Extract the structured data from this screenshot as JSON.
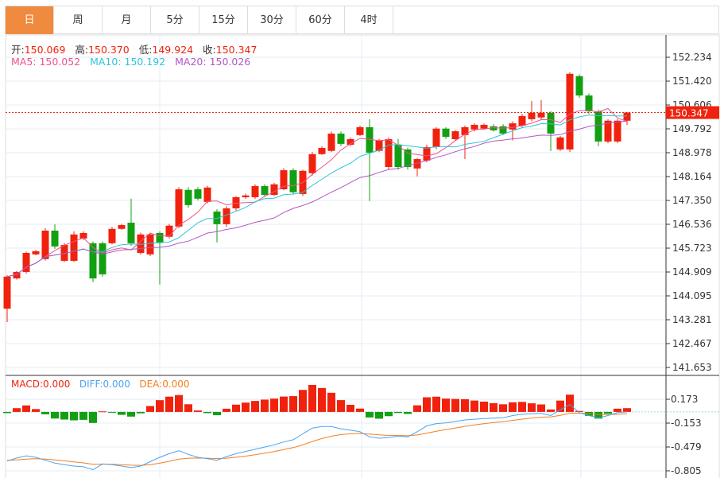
{
  "tabs": [
    {
      "label": "日",
      "active": true
    },
    {
      "label": "周"
    },
    {
      "label": "月"
    },
    {
      "label": "5分"
    },
    {
      "label": "15分"
    },
    {
      "label": "30分"
    },
    {
      "label": "60分"
    },
    {
      "label": "4时"
    }
  ],
  "ohlc_info": {
    "open_label": "开:",
    "open": "150.069",
    "high_label": "高:",
    "high": "150.370",
    "low_label": "低:",
    "low": "149.924",
    "close_label": "收:",
    "close": "150.347"
  },
  "ma_info": {
    "ma5": "MA5: 150.052",
    "ma10": "MA10: 150.192",
    "ma20": "MA20: 150.026"
  },
  "macd_info": {
    "macd": "MACD:0.000",
    "diff": "DIFF:0.000",
    "dea": "DEA:0.000"
  },
  "current_price": "150.347",
  "colors": {
    "up": "#f0220e",
    "down": "#12a012",
    "ma5": "#f0528a",
    "ma10": "#2ec4d8",
    "ma20": "#b156c4",
    "diff": "#4aa3f0",
    "dea": "#f57e20",
    "accent": "#f08a3e"
  },
  "chart_data": {
    "type": "candlestick",
    "price_axis": {
      "ticks": [
        "152.234",
        "151.420",
        "150.606",
        "149.792",
        "148.978",
        "148.164",
        "147.350",
        "146.536",
        "145.723",
        "144.909",
        "144.095",
        "143.281",
        "142.467",
        "141.653"
      ],
      "range": [
        141.653,
        152.234
      ]
    },
    "macd_axis": {
      "ticks": [
        "0.173",
        "-0.153",
        "-0.479",
        "-0.805"
      ],
      "range": [
        -0.805,
        0.173
      ]
    },
    "candles": [
      [
        143.66,
        144.75,
        144.8,
        143.2
      ],
      [
        144.69,
        144.91,
        144.95,
        144.65
      ],
      [
        144.91,
        145.56,
        145.6,
        144.85
      ],
      [
        145.51,
        145.62,
        145.66,
        145.48
      ],
      [
        145.35,
        146.32,
        146.4,
        145.3
      ],
      [
        146.32,
        145.78,
        146.54,
        145.7
      ],
      [
        145.29,
        145.83,
        145.9,
        145.25
      ],
      [
        145.29,
        146.19,
        146.3,
        145.25
      ],
      [
        146.05,
        146.24,
        146.3,
        146.0
      ],
      [
        145.89,
        144.69,
        145.95,
        144.56
      ],
      [
        145.89,
        144.83,
        145.95,
        144.75
      ],
      [
        145.89,
        146.38,
        146.45,
        145.85
      ],
      [
        146.38,
        146.51,
        146.55,
        146.35
      ],
      [
        146.59,
        145.89,
        147.41,
        145.8
      ],
      [
        145.56,
        146.19,
        146.25,
        145.5
      ],
      [
        145.51,
        146.19,
        146.25,
        145.45
      ],
      [
        146.24,
        145.92,
        146.3,
        144.48
      ],
      [
        146.11,
        146.49,
        146.55,
        146.05
      ],
      [
        146.46,
        147.73,
        147.8,
        146.4
      ],
      [
        147.71,
        147.19,
        147.8,
        147.1
      ],
      [
        147.73,
        147.41,
        147.8,
        147.35
      ],
      [
        147.3,
        147.79,
        147.85,
        147.25
      ],
      [
        146.97,
        146.54,
        147.05,
        145.92
      ],
      [
        146.54,
        147.08,
        147.15,
        146.45
      ],
      [
        147.08,
        147.46,
        147.5,
        147.0
      ],
      [
        147.46,
        147.52,
        147.58,
        147.4
      ],
      [
        147.46,
        147.84,
        147.9,
        147.4
      ],
      [
        147.84,
        147.54,
        147.9,
        147.5
      ],
      [
        147.54,
        147.9,
        147.95,
        147.5
      ],
      [
        147.73,
        148.38,
        148.45,
        147.7
      ],
      [
        148.38,
        147.63,
        148.45,
        147.55
      ],
      [
        147.57,
        148.36,
        148.4,
        147.5
      ],
      [
        148.28,
        148.93,
        149.0,
        148.2
      ],
      [
        148.93,
        149.14,
        149.2,
        148.9
      ],
      [
        149.04,
        149.63,
        149.7,
        149.0
      ],
      [
        149.63,
        149.28,
        149.7,
        149.2
      ],
      [
        149.25,
        149.44,
        149.5,
        149.2
      ],
      [
        149.58,
        149.85,
        149.9,
        149.55
      ],
      [
        149.85,
        148.98,
        150.12,
        147.33
      ],
      [
        149.04,
        149.39,
        149.45,
        149.0
      ],
      [
        148.49,
        149.44,
        149.5,
        148.4
      ],
      [
        149.25,
        148.49,
        149.45,
        148.4
      ],
      [
        149.09,
        148.49,
        149.15,
        148.4
      ],
      [
        148.44,
        148.76,
        148.8,
        148.17
      ],
      [
        148.71,
        149.17,
        149.25,
        148.65
      ],
      [
        149.17,
        149.8,
        149.85,
        149.1
      ],
      [
        149.8,
        149.52,
        149.85,
        149.45
      ],
      [
        149.44,
        149.71,
        149.75,
        149.4
      ],
      [
        149.58,
        149.85,
        149.9,
        148.76
      ],
      [
        149.77,
        149.93,
        149.98,
        149.7
      ],
      [
        149.8,
        149.93,
        149.98,
        149.75
      ],
      [
        149.88,
        149.74,
        149.95,
        149.7
      ],
      [
        149.88,
        149.63,
        149.95,
        149.58
      ],
      [
        149.77,
        149.98,
        150.05,
        149.4
      ],
      [
        149.9,
        150.23,
        150.3,
        149.85
      ],
      [
        150.12,
        150.34,
        150.74,
        150.05
      ],
      [
        150.18,
        150.34,
        150.77,
        150.1
      ],
      [
        150.34,
        149.63,
        150.4,
        149.04
      ],
      [
        149.09,
        149.5,
        149.55,
        149.04
      ],
      [
        149.09,
        151.67,
        151.72,
        149.0
      ],
      [
        151.59,
        150.93,
        151.65,
        150.85
      ],
      [
        150.93,
        150.39,
        151.0,
        150.3
      ],
      [
        150.39,
        149.36,
        150.45,
        149.2
      ],
      [
        149.36,
        150.07,
        150.12,
        149.3
      ],
      [
        149.36,
        150.07,
        150.12,
        149.3
      ],
      [
        150.069,
        150.347,
        150.37,
        149.924
      ]
    ],
    "diff": [
      -0.67,
      -0.63,
      -0.6,
      -0.62,
      -0.66,
      -0.7,
      -0.72,
      -0.74,
      -0.75,
      -0.79,
      -0.71,
      -0.72,
      -0.74,
      -0.76,
      -0.74,
      -0.68,
      -0.62,
      -0.57,
      -0.53,
      -0.58,
      -0.62,
      -0.64,
      -0.66,
      -0.61,
      -0.57,
      -0.54,
      -0.51,
      -0.48,
      -0.45,
      -0.41,
      -0.38,
      -0.3,
      -0.22,
      -0.2,
      -0.2,
      -0.23,
      -0.25,
      -0.27,
      -0.34,
      -0.36,
      -0.35,
      -0.33,
      -0.34,
      -0.27,
      -0.19,
      -0.16,
      -0.15,
      -0.13,
      -0.11,
      -0.1,
      -0.09,
      -0.085,
      -0.08,
      -0.05,
      -0.03,
      -0.025,
      -0.02,
      -0.05,
      0.03,
      0.1,
      -0.01,
      -0.05,
      -0.08,
      -0.05,
      -0.01,
      0.0
    ],
    "dea_start": -0.66
  }
}
